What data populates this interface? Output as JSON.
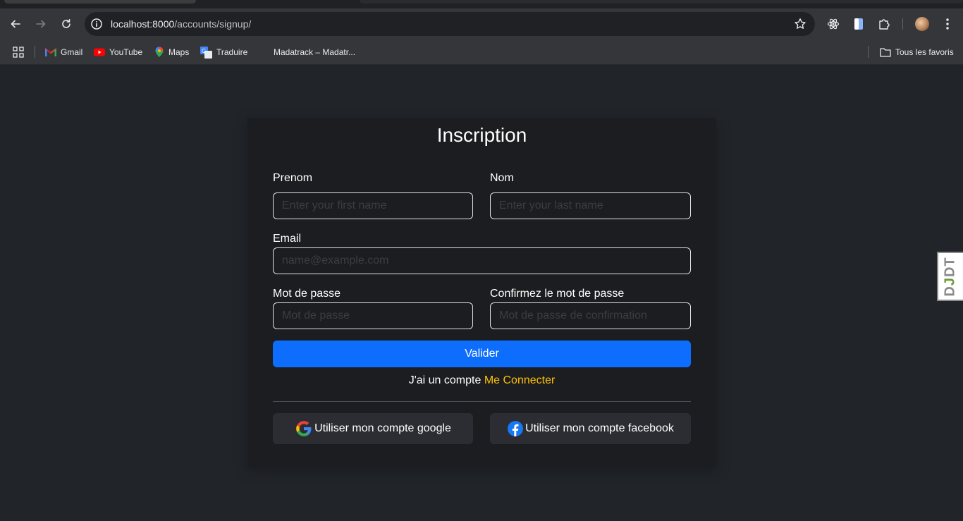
{
  "browser": {
    "url_host": "localhost:8000",
    "url_path": "/accounts/signup/",
    "bookmarks": [
      {
        "label": "Gmail",
        "icon": "gmail-icon"
      },
      {
        "label": "YouTube",
        "icon": "youtube-icon"
      },
      {
        "label": "Maps",
        "icon": "maps-icon"
      },
      {
        "label": "Traduire",
        "icon": "translate-icon"
      },
      {
        "label": "Madatrack – Madatr...",
        "icon": "site-icon"
      }
    ],
    "all_bookmarks_label": "Tous les favoris"
  },
  "form": {
    "title": "Inscription",
    "first_name": {
      "label": "Prenom",
      "placeholder": "Enter your first name"
    },
    "last_name": {
      "label": "Nom",
      "placeholder": "Enter your last name"
    },
    "email": {
      "label": "Email",
      "placeholder": "name@example.com"
    },
    "password": {
      "label": "Mot de passe",
      "placeholder": "Mot de passe"
    },
    "password_confirm": {
      "label": "Confirmez le mot de passe",
      "placeholder": "Mot de passe de confirmation"
    },
    "submit_label": "Valider",
    "have_account_text": "J'ai un compte",
    "login_link_label": "Me Connecter",
    "google_label": "Utiliser mon compte google",
    "facebook_label": "Utiliser mon compte facebook"
  },
  "debug_toolbar": {
    "label_d": "D",
    "label_j": "J",
    "label_dt": "DT"
  },
  "colors": {
    "accent": "#0d6efd",
    "link": "#ffc107",
    "page_bg": "#212429",
    "card_bg": "#1c1d20"
  }
}
